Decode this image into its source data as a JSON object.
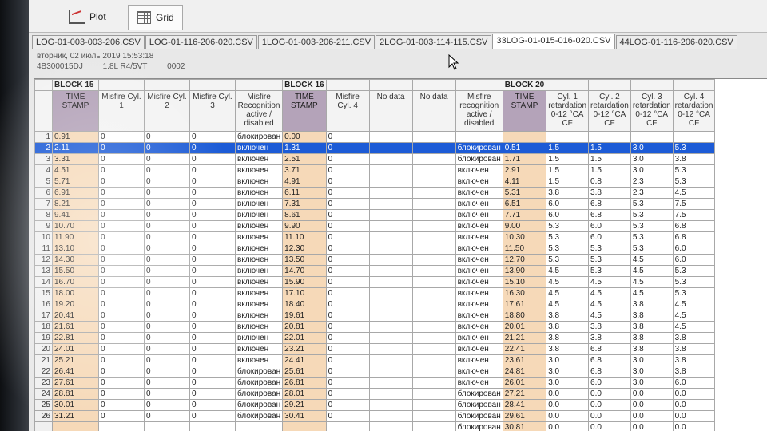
{
  "toolbar": {
    "plot_label": "Plot",
    "grid_label": "Grid"
  },
  "file_tabs": [
    {
      "label": "LOG-01-003-003-206.CSV"
    },
    {
      "label": "LOG-01-116-206-020.CSV"
    },
    {
      "label": "1LOG-01-003-206-211.CSV"
    },
    {
      "label": "2LOG-01-003-114-115.CSV"
    },
    {
      "label": "33LOG-01-015-016-020.CSV"
    },
    {
      "label": "44LOG-01-116-206-020.CSV"
    }
  ],
  "info": {
    "date": "вторник, 02 июль 2019 15:53:18",
    "vin": "4B300015DJ",
    "engine": "1.8L R4/5VT",
    "code": "0002"
  },
  "blocks": {
    "b15": "BLOCK 15",
    "b16": "BLOCK 16",
    "b20": "BLOCK 20"
  },
  "headers": [
    "TIME STAMP",
    "Misfire Cyl. 1",
    "Misfire Cyl. 2",
    "Misfire Cyl. 3",
    "Misfire Recognition active / disabled",
    "TIME STAMP",
    "Misfire Cyl. 4",
    "No data",
    "No data",
    "Misfire recognition active / disabled",
    "TIME STAMP",
    "Cyl. 1 retardation 0-12 °CA CF",
    "Cyl. 2 retardation 0-12 °CA CF",
    "Cyl. 3 retardation 0-12 °CA CF",
    "Cyl. 4 retardation 0-12 °CA CF"
  ],
  "rows": [
    [
      "1",
      "0.91",
      "0",
      "0",
      "0",
      "блокирован",
      "0.00",
      "0",
      "",
      "",
      "",
      "",
      "",
      "",
      "",
      ""
    ],
    [
      "2",
      "2.11",
      "0",
      "0",
      "0",
      "включен",
      "1.31",
      "0",
      "",
      "",
      "блокирован",
      "0.51",
      "1.5",
      "1.5",
      "3.0",
      "5.3"
    ],
    [
      "3",
      "3.31",
      "0",
      "0",
      "0",
      "включен",
      "2.51",
      "0",
      "",
      "",
      "блокирован",
      "1.71",
      "1.5",
      "1.5",
      "3.0",
      "3.8"
    ],
    [
      "4",
      "4.51",
      "0",
      "0",
      "0",
      "включен",
      "3.71",
      "0",
      "",
      "",
      "включен",
      "2.91",
      "1.5",
      "1.5",
      "3.0",
      "5.3"
    ],
    [
      "5",
      "5.71",
      "0",
      "0",
      "0",
      "включен",
      "4.91",
      "0",
      "",
      "",
      "включен",
      "4.11",
      "1.5",
      "0.8",
      "2.3",
      "5.3"
    ],
    [
      "6",
      "6.91",
      "0",
      "0",
      "0",
      "включен",
      "6.11",
      "0",
      "",
      "",
      "включен",
      "5.31",
      "3.8",
      "3.8",
      "2.3",
      "4.5"
    ],
    [
      "7",
      "8.21",
      "0",
      "0",
      "0",
      "включен",
      "7.31",
      "0",
      "",
      "",
      "включен",
      "6.51",
      "6.0",
      "6.8",
      "5.3",
      "7.5"
    ],
    [
      "8",
      "9.41",
      "0",
      "0",
      "0",
      "включен",
      "8.61",
      "0",
      "",
      "",
      "включен",
      "7.71",
      "6.0",
      "6.8",
      "5.3",
      "7.5"
    ],
    [
      "9",
      "10.70",
      "0",
      "0",
      "0",
      "включен",
      "9.90",
      "0",
      "",
      "",
      "включен",
      "9.00",
      "5.3",
      "6.0",
      "5.3",
      "6.8"
    ],
    [
      "10",
      "11.90",
      "0",
      "0",
      "0",
      "включен",
      "11.10",
      "0",
      "",
      "",
      "включен",
      "10.30",
      "5.3",
      "6.0",
      "5.3",
      "6.8"
    ],
    [
      "11",
      "13.10",
      "0",
      "0",
      "0",
      "включен",
      "12.30",
      "0",
      "",
      "",
      "включен",
      "11.50",
      "5.3",
      "5.3",
      "5.3",
      "6.0"
    ],
    [
      "12",
      "14.30",
      "0",
      "0",
      "0",
      "включен",
      "13.50",
      "0",
      "",
      "",
      "включен",
      "12.70",
      "5.3",
      "5.3",
      "4.5",
      "6.0"
    ],
    [
      "13",
      "15.50",
      "0",
      "0",
      "0",
      "включен",
      "14.70",
      "0",
      "",
      "",
      "включен",
      "13.90",
      "4.5",
      "5.3",
      "4.5",
      "5.3"
    ],
    [
      "14",
      "16.70",
      "0",
      "0",
      "0",
      "включен",
      "15.90",
      "0",
      "",
      "",
      "включен",
      "15.10",
      "4.5",
      "4.5",
      "4.5",
      "5.3"
    ],
    [
      "15",
      "18.00",
      "0",
      "0",
      "0",
      "включен",
      "17.10",
      "0",
      "",
      "",
      "включен",
      "16.30",
      "4.5",
      "4.5",
      "4.5",
      "5.3"
    ],
    [
      "16",
      "19.20",
      "0",
      "0",
      "0",
      "включен",
      "18.40",
      "0",
      "",
      "",
      "включен",
      "17.61",
      "4.5",
      "4.5",
      "3.8",
      "4.5"
    ],
    [
      "17",
      "20.41",
      "0",
      "0",
      "0",
      "включен",
      "19.61",
      "0",
      "",
      "",
      "включен",
      "18.80",
      "3.8",
      "4.5",
      "3.8",
      "4.5"
    ],
    [
      "18",
      "21.61",
      "0",
      "0",
      "0",
      "включен",
      "20.81",
      "0",
      "",
      "",
      "включен",
      "20.01",
      "3.8",
      "3.8",
      "3.8",
      "4.5"
    ],
    [
      "19",
      "22.81",
      "0",
      "0",
      "0",
      "включен",
      "22.01",
      "0",
      "",
      "",
      "включен",
      "21.21",
      "3.8",
      "3.8",
      "3.8",
      "3.8"
    ],
    [
      "20",
      "24.01",
      "0",
      "0",
      "0",
      "включен",
      "23.21",
      "0",
      "",
      "",
      "включен",
      "22.41",
      "3.8",
      "6.8",
      "3.8",
      "3.8"
    ],
    [
      "21",
      "25.21",
      "0",
      "0",
      "0",
      "включен",
      "24.41",
      "0",
      "",
      "",
      "включен",
      "23.61",
      "3.0",
      "6.8",
      "3.0",
      "3.8"
    ],
    [
      "22",
      "26.41",
      "0",
      "0",
      "0",
      "блокирован",
      "25.61",
      "0",
      "",
      "",
      "включен",
      "24.81",
      "3.0",
      "6.8",
      "3.0",
      "3.8"
    ],
    [
      "23",
      "27.61",
      "0",
      "0",
      "0",
      "блокирован",
      "26.81",
      "0",
      "",
      "",
      "включен",
      "26.01",
      "3.0",
      "6.0",
      "3.0",
      "6.0"
    ],
    [
      "24",
      "28.81",
      "0",
      "0",
      "0",
      "блокирован",
      "28.01",
      "0",
      "",
      "",
      "блокирован",
      "27.21",
      "0.0",
      "0.0",
      "0.0",
      "0.0"
    ],
    [
      "25",
      "30.01",
      "0",
      "0",
      "0",
      "блокирован",
      "29.21",
      "0",
      "",
      "",
      "блокирован",
      "28.41",
      "0.0",
      "0.0",
      "0.0",
      "0.0"
    ],
    [
      "26",
      "31.21",
      "0",
      "0",
      "0",
      "блокирован",
      "30.41",
      "0",
      "",
      "",
      "блокирован",
      "29.61",
      "0.0",
      "0.0",
      "0.0",
      "0.0"
    ],
    [
      "",
      "",
      "",
      "",
      "",
      "",
      "",
      "",
      "",
      "",
      "блокирован",
      "30.81",
      "0.0",
      "0.0",
      "0.0",
      "0.0"
    ]
  ]
}
